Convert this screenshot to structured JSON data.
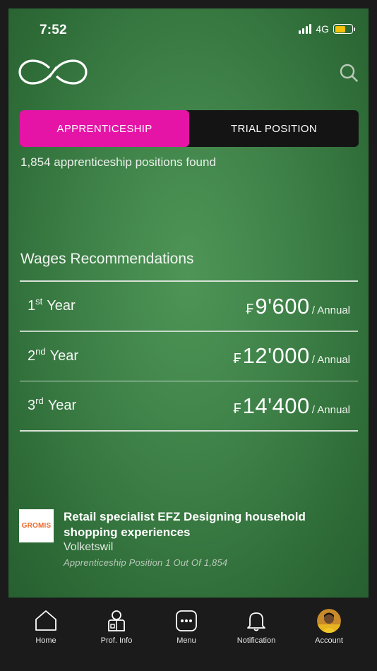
{
  "status_bar": {
    "time": "7:52",
    "network": "4G"
  },
  "icons": {
    "logo": "infinity-logo",
    "search": "search-icon"
  },
  "filter": {
    "tabs": [
      {
        "label": "APPRENTICESHIP",
        "active": true
      },
      {
        "label": "TRIAL POSITION",
        "active": false
      }
    ],
    "results_text": "1,854 apprenticeship positions found"
  },
  "wages": {
    "title": "Wages Recommendations",
    "rows": [
      {
        "ordinal": "1",
        "suffix": "st",
        "label": "Year",
        "currency": "₣",
        "amount": "9'600",
        "period": "/ Annual"
      },
      {
        "ordinal": "2",
        "suffix": "nd",
        "label": "Year",
        "currency": "₣",
        "amount": "12'000",
        "period": "/ Annual"
      },
      {
        "ordinal": "3",
        "suffix": "rd",
        "label": "Year",
        "currency": "₣",
        "amount": "14'400",
        "period": "/ Annual"
      }
    ]
  },
  "job": {
    "company_logo_text": "GROMIS",
    "title": "Retail specialist EFZ Designing household shopping experiences",
    "location": "Volketswil",
    "position_text": "Apprenticeship Position 1 Out Of 1,854"
  },
  "nav": [
    {
      "label": "Home",
      "icon": "home-icon"
    },
    {
      "label": "Prof. Info",
      "icon": "profile-icon"
    },
    {
      "label": "Menu",
      "icon": "menu-icon"
    },
    {
      "label": "Notification",
      "icon": "bell-icon"
    },
    {
      "label": "Account",
      "icon": "avatar"
    }
  ],
  "colors": {
    "accent": "#e514a7",
    "background": "#3f8249",
    "company_logo_text": "#ef6a2a",
    "battery": "#f4c20d"
  }
}
